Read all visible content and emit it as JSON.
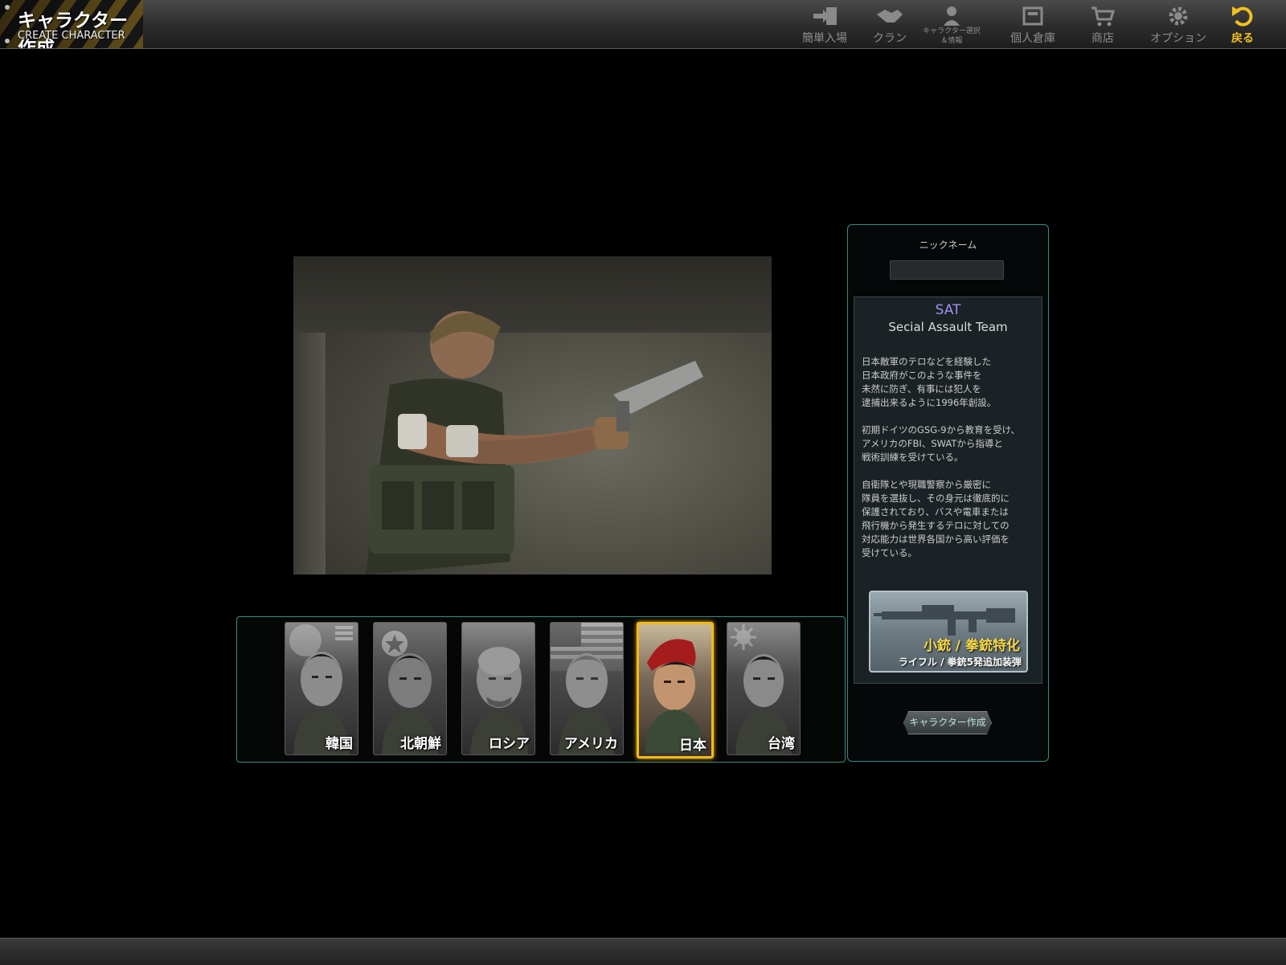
{
  "header": {
    "title_jp": "キャラクター作成",
    "title_en": "CREATE CHARACTER"
  },
  "nav": [
    {
      "label": "簡単入場",
      "icon": "enter-door-icon"
    },
    {
      "label": "クラン",
      "icon": "handshake-icon"
    },
    {
      "label": "キャラクター選択\n＆情報",
      "icon": "person-icon"
    },
    {
      "label": "個人倉庫",
      "icon": "storage-box-icon"
    },
    {
      "label": "商店",
      "icon": "shopping-cart-icon"
    },
    {
      "label": "オプション",
      "icon": "gear-icon"
    },
    {
      "label": "戻る",
      "icon": "back-arrow-icon"
    }
  ],
  "characters": [
    {
      "name": "韓国",
      "flag": "korea-flag"
    },
    {
      "name": "北朝鮮",
      "flag": "north-korea-flag"
    },
    {
      "name": "ロシア",
      "flag": "none"
    },
    {
      "name": "アメリカ",
      "flag": "usa-flag"
    },
    {
      "name": "日本",
      "flag": "japan-flag",
      "selected": true
    },
    {
      "name": "台湾",
      "flag": "taiwan-flag"
    }
  ],
  "panel": {
    "nickname_label": "ニックネーム",
    "nickname_value": "",
    "team_abbr": "SAT",
    "team_full": "Secial Assault Team",
    "desc_1": "日本敵軍のテロなどを経験した\n日本政府がこのような事件を\n未然に防ぎ、有事には犯人を\n逮捕出来るように1996年創設。",
    "desc_2": "初期ドイツのGSG-9から教育を受け、\nアメリカのFBI、SWATから指導と\n戦術訓練を受けている。",
    "desc_3": "自衛隊とや現職警察から厳密に\n隊員を選抜し、その身元は徹底的に\n保護されており、バスや電車または\n飛行機から発生するテロに対しての\n対応能力は世界各国から高い評価を\n受けている。",
    "weapon_title": "小銃 / 拳銃特化",
    "weapon_sub": "ライフル / 拳銃5発追加装弾",
    "create_button": "キャラクター作成"
  },
  "colors": {
    "accent_gold": "#f3b91c",
    "panel_border": "#3d8a80",
    "team_name": "#a38ef0"
  }
}
